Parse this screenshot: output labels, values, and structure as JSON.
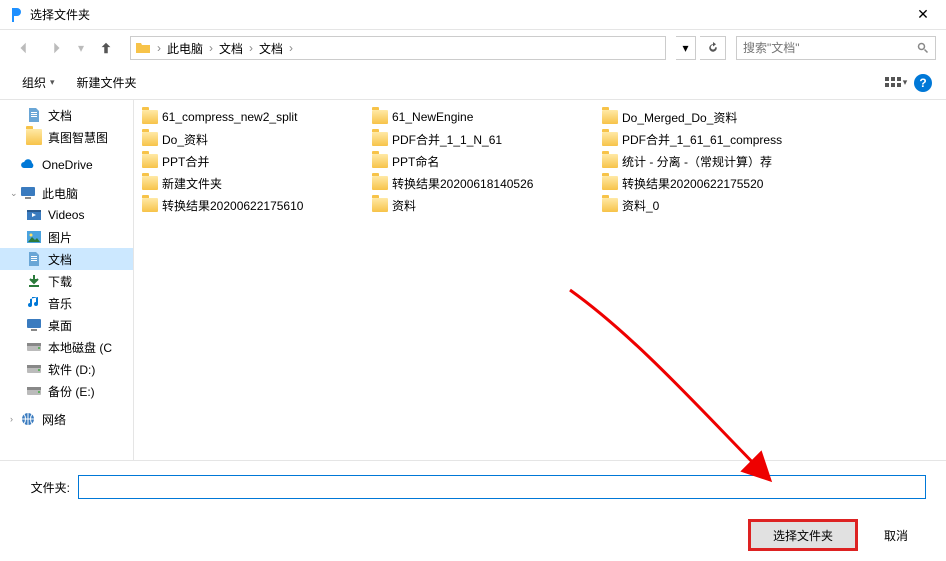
{
  "window": {
    "title": "选择文件夹"
  },
  "breadcrumb": {
    "items": [
      "此电脑",
      "文档",
      "文档"
    ]
  },
  "search": {
    "placeholder": "搜索\"文档\""
  },
  "toolbar": {
    "organize": "组织",
    "new_folder": "新建文件夹"
  },
  "sidebar": {
    "quick": [
      {
        "label": "文档",
        "icon": "doc"
      },
      {
        "label": "真图智慧图",
        "icon": "folder"
      }
    ],
    "onedrive": {
      "label": "OneDrive"
    },
    "thispc": {
      "label": "此电脑",
      "children": [
        {
          "label": "Videos",
          "icon": "video"
        },
        {
          "label": "图片",
          "icon": "picture"
        },
        {
          "label": "文档",
          "icon": "doc",
          "selected": true
        },
        {
          "label": "下载",
          "icon": "download"
        },
        {
          "label": "音乐",
          "icon": "music"
        },
        {
          "label": "桌面",
          "icon": "desktop"
        },
        {
          "label": "本地磁盘 (C",
          "icon": "disk"
        },
        {
          "label": "软件 (D:)",
          "icon": "disk"
        },
        {
          "label": "备份 (E:)",
          "icon": "disk"
        }
      ]
    },
    "network": {
      "label": "网络"
    }
  },
  "folders": [
    "61_compress_new2_split",
    "61_NewEngine",
    "Do_Merged_Do_资料",
    "Do_资料",
    "PDF合并_1_1_N_61",
    "PDF合并_1_61_61_compress",
    "PPT合并",
    "PPT命名",
    "统计 - 分离 -（常规计算）荐",
    "新建文件夹",
    "转换结果20200618140526",
    "转换结果20200622175520",
    "转换结果20200622175610",
    "资料",
    "资料_0"
  ],
  "footer": {
    "label": "文件夹:",
    "value": "",
    "select": "选择文件夹",
    "cancel": "取消"
  }
}
